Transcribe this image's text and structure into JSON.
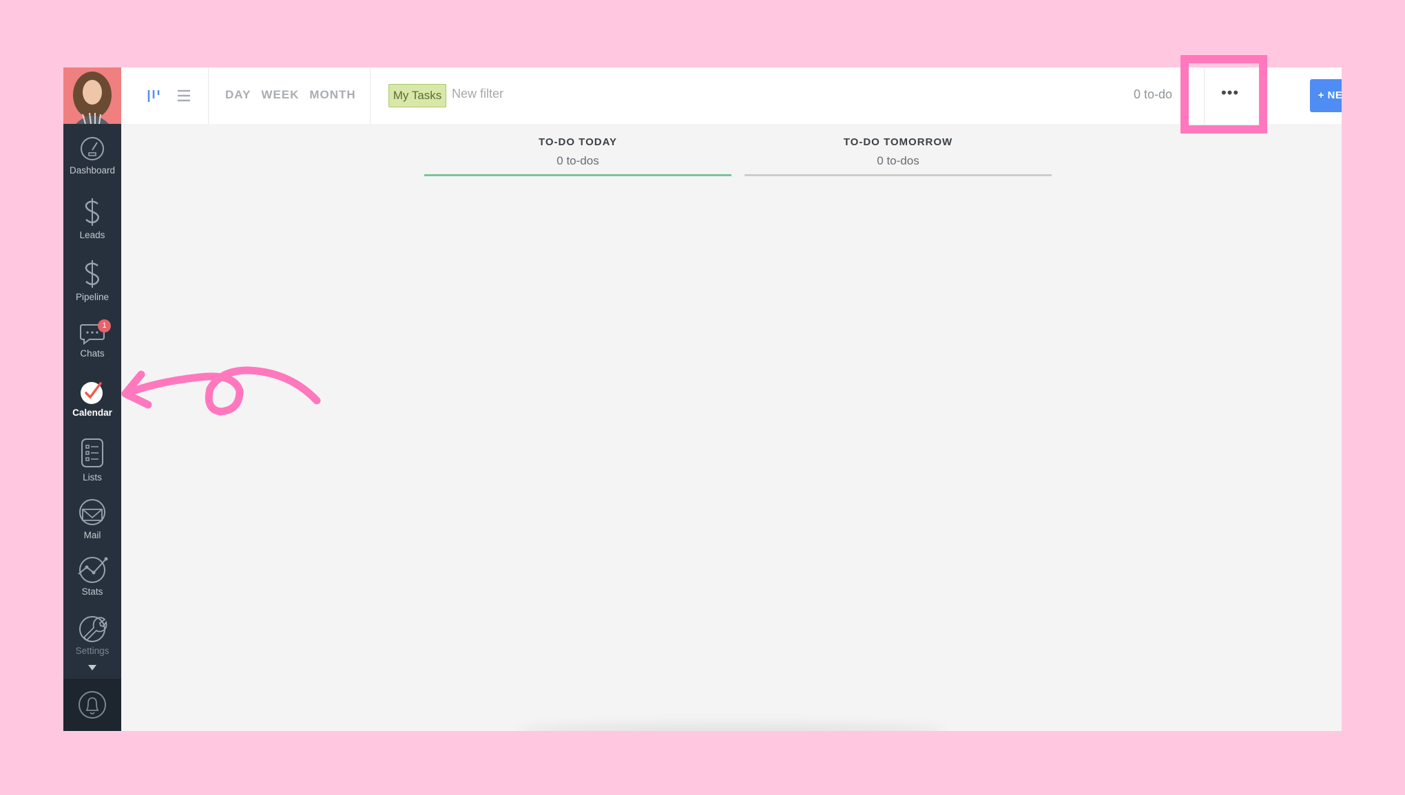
{
  "sidebar": {
    "items": [
      {
        "label": "Dashboard",
        "icon": "dashboard-gauge-icon"
      },
      {
        "label": "Leads",
        "icon": "dollar-icon"
      },
      {
        "label": "Pipeline",
        "icon": "dollar-icon"
      },
      {
        "label": "Chats",
        "icon": "chat-bubble-icon",
        "badge": "1"
      },
      {
        "label": "Calendar",
        "icon": "check-circle-icon",
        "active": true
      },
      {
        "label": "Lists",
        "icon": "list-icon"
      },
      {
        "label": "Mail",
        "icon": "mail-icon"
      },
      {
        "label": "Stats",
        "icon": "stats-icon"
      },
      {
        "label": "Settings",
        "icon": "wrench-icon"
      }
    ],
    "bottom_icon": "bell-icon"
  },
  "toolbar": {
    "view_tabs": [
      "DAY",
      "WEEK",
      "MONTH"
    ],
    "filter_chip": "My Tasks",
    "filter_placeholder": "New filter",
    "todo_count": "0 to-do",
    "more_label": "•••",
    "new_task_label": "+ NEW TASK"
  },
  "columns": [
    {
      "title": "TO-DO TODAY",
      "count": "0 to-dos",
      "accent": "#7cc49a"
    },
    {
      "title": "TO-DO TOMORROW",
      "count": "0 to-dos",
      "accent": "#cccccc"
    }
  ],
  "colors": {
    "page_background": "#ffc8e0",
    "sidebar": "#27313d",
    "primary_button": "#4f8df5",
    "annotation": "#ff78bd"
  }
}
